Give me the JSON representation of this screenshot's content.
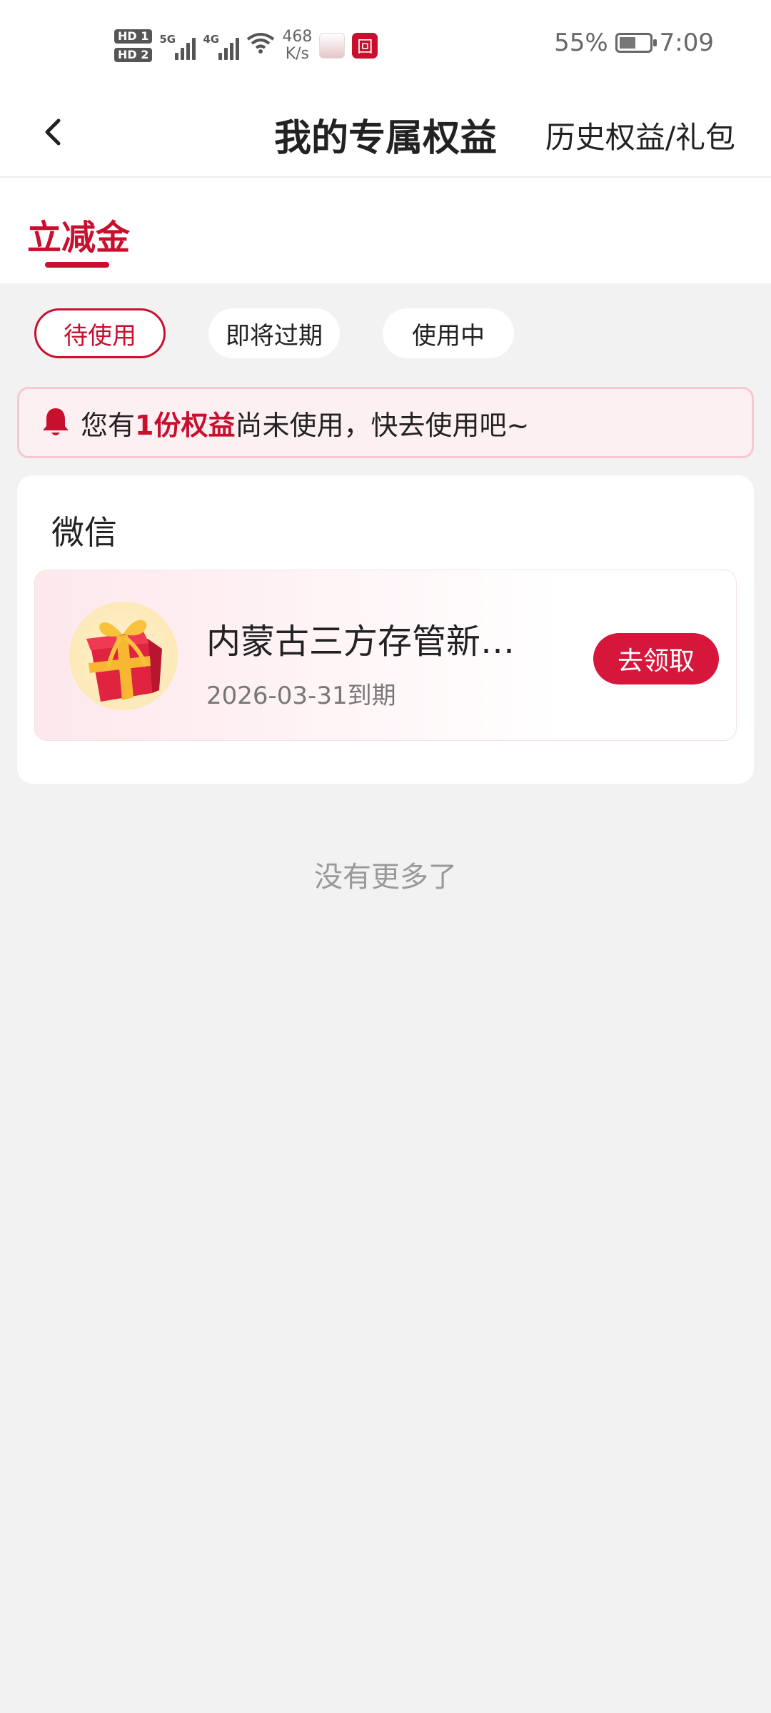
{
  "status_bar": {
    "hd1": "HD 1",
    "hd2": "HD 2",
    "net1": "5G",
    "net2": "4G",
    "speed_value": "468",
    "speed_unit": "K/s",
    "app2_glyph": "回",
    "battery": "55%",
    "time": "7:09"
  },
  "header": {
    "back_glyph": "‹",
    "title": "我的专属权益",
    "history_link": "历史权益/礼包"
  },
  "tabs": [
    {
      "label": "立减金",
      "active": true
    }
  ],
  "filters": [
    {
      "label": "待使用",
      "active": true
    },
    {
      "label": "即将过期",
      "active": false
    },
    {
      "label": "使用中",
      "active": false
    }
  ],
  "notice": {
    "prefix": "您有",
    "highlight": "1份权益",
    "suffix": "尚未使用，快去使用吧~"
  },
  "group": {
    "title": "微信",
    "items": [
      {
        "name": "内蒙古三方存管新…",
        "expiry": "2026-03-31到期",
        "button": "去领取"
      }
    ]
  },
  "footer": {
    "no_more": "没有更多了"
  },
  "colors": {
    "accent": "#c8102e",
    "button": "#d7163c",
    "background": "#f2f2f2"
  }
}
